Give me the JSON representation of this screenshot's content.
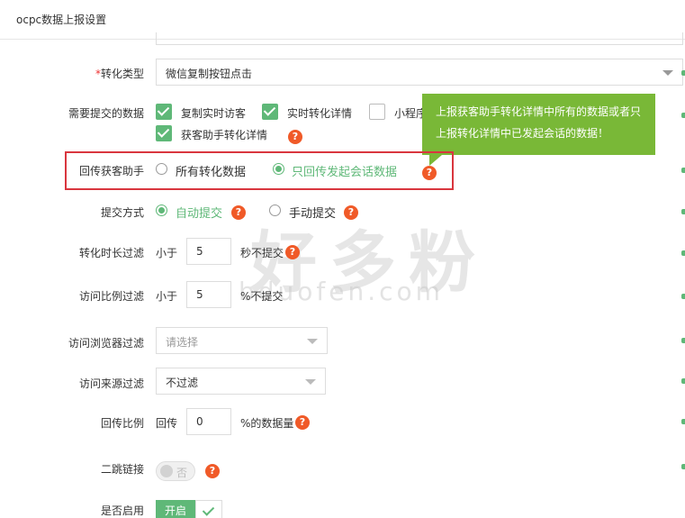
{
  "header": {
    "title": "ocpc数据上报设置"
  },
  "conversion_type": {
    "label_req": "*",
    "label": "转化类型",
    "value": "微信复制按钮点击"
  },
  "submit_data": {
    "label": "需要提交的数据",
    "options": [
      {
        "label": "复制实时访客",
        "checked": true
      },
      {
        "label": "实时转化详情",
        "checked": true
      },
      {
        "label": "小程序",
        "checked": false
      },
      {
        "label": "获客助手转化详情",
        "checked": true
      }
    ]
  },
  "tooltip": {
    "text": "上报获客助手转化详情中所有的数据或者只上报转化详情中已发起会话的数据！"
  },
  "callback_helper": {
    "label": "回传获客助手",
    "option_all": "所有转化数据",
    "option_session": "只回传发起会话数据",
    "selected": "只回传发起会话数据"
  },
  "submit_method": {
    "label": "提交方式",
    "option_auto": "自动提交",
    "option_manual": "手动提交",
    "selected": "自动提交"
  },
  "duration_filter": {
    "label": "转化时长过滤",
    "prefix": "小于",
    "value": "5",
    "suffix": "秒不提交"
  },
  "visit_ratio_filter": {
    "label": "访问比例过滤",
    "prefix": "小于",
    "value": "5",
    "suffix": "%不提交"
  },
  "browser_filter": {
    "label": "访问浏览器过滤",
    "placeholder": "请选择"
  },
  "source_filter": {
    "label": "访问来源过滤",
    "value": "不过滤"
  },
  "callback_ratio": {
    "label": "回传比例",
    "prefix": "回传",
    "value": "0",
    "suffix": "%的数据量"
  },
  "second_jump": {
    "label": "二跳链接",
    "state_text": "否",
    "enabled": false
  },
  "enable": {
    "label": "是否启用",
    "button_text": "开启",
    "enabled": true
  },
  "help_icon_glyph": "?",
  "watermark": {
    "main": "好多粉",
    "sub": "bduofen.com"
  },
  "colors": {
    "accent_green": "#5fb878",
    "tooltip_green": "#79b837",
    "help_orange": "#f05a28",
    "highlight_red": "#d9363e"
  }
}
